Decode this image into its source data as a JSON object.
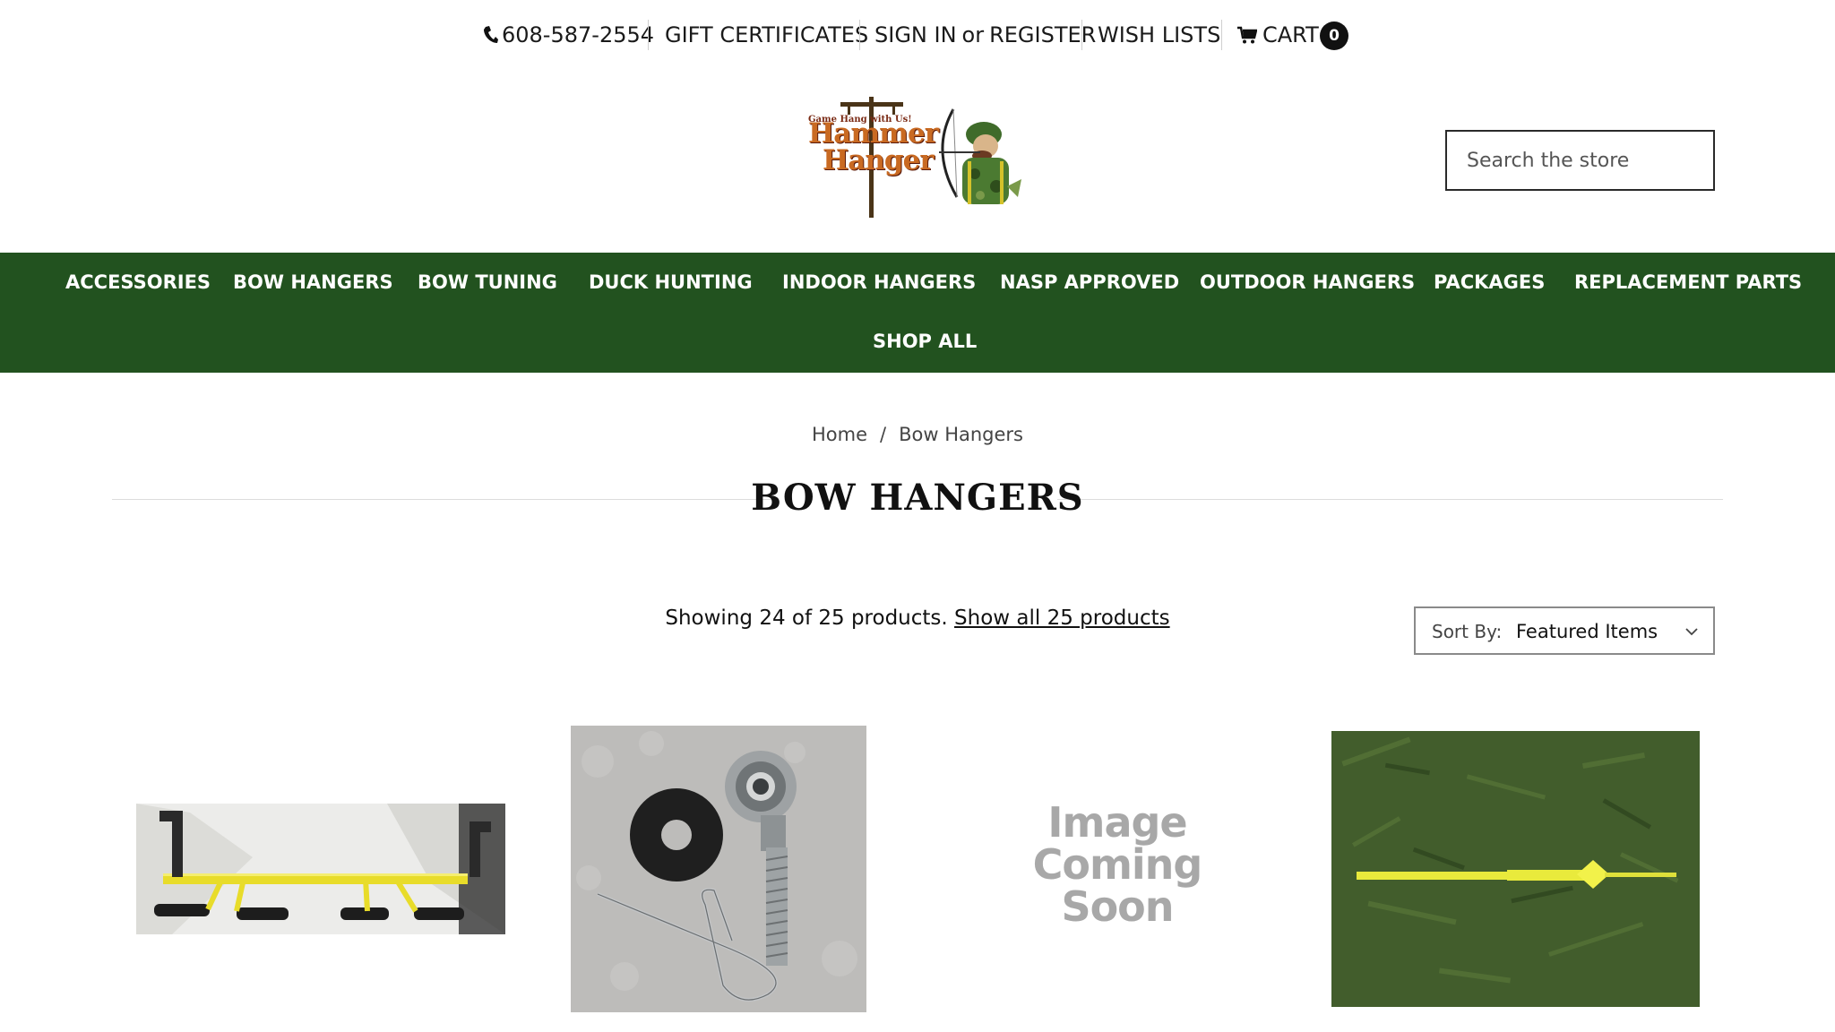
{
  "topbar": {
    "phone": "608-587-2554",
    "gift": "GIFT CERTIFICATES",
    "sign_in": "SIGN IN",
    "or": "or",
    "register": "REGISTER",
    "wish": "WISH LISTS",
    "cart": "CART",
    "cart_count": "0"
  },
  "logo": {
    "line1": "Game Hang with Us!",
    "line2": "Hammer",
    "line3": "Hanger"
  },
  "search": {
    "placeholder": "Search the store"
  },
  "nav": {
    "items": [
      "ACCESSORIES",
      "BOW HANGERS",
      "BOW TUNING",
      "DUCK HUNTING",
      "INDOOR HANGERS",
      "NASP APPROVED",
      "OUTDOOR HANGERS",
      "PACKAGES",
      "REPLACEMENT PARTS",
      "SHOP ALL"
    ]
  },
  "breadcrumb": {
    "home": "Home",
    "current": "Bow Hangers"
  },
  "title": "BOW HANGERS",
  "listing": {
    "showing": "Showing 24 of 25 products.",
    "show_all": "Show all 25 products"
  },
  "sort": {
    "label": "Sort By:",
    "value": "Featured Items"
  },
  "products": {
    "placeholder_text": "Image Coming Soon"
  },
  "colors": {
    "nav_bg": "#22521f",
    "brand_green": "#22521f"
  }
}
